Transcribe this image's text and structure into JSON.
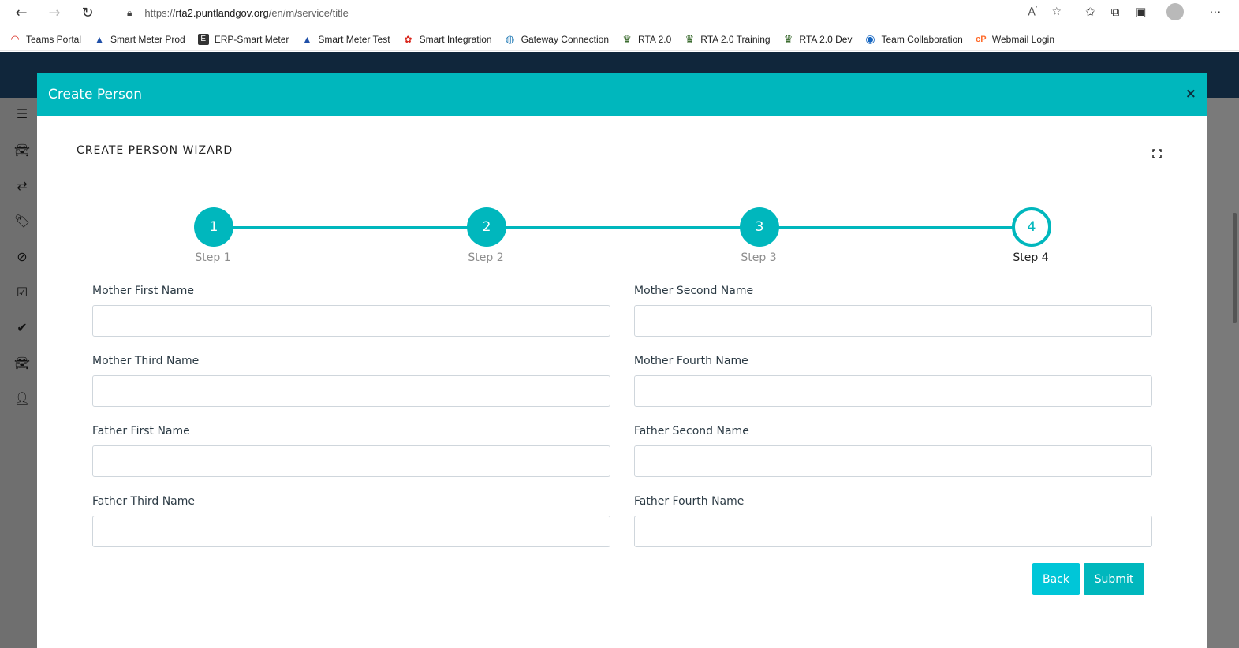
{
  "browser": {
    "url_prefix": "https://",
    "url_host": "rta2.puntlandgov.org",
    "url_path": "/en/m/service/title",
    "bookmarks": [
      {
        "label": "Teams Portal",
        "color": "#d9261c"
      },
      {
        "label": "Smart Meter Prod",
        "color": "#1f4fa8"
      },
      {
        "label": "ERP-Smart Meter",
        "color": "#333333"
      },
      {
        "label": "Smart Meter Test",
        "color": "#1f4fa8"
      },
      {
        "label": "Smart Integration",
        "color": "#d9261c"
      },
      {
        "label": "Gateway Connection",
        "color": "#2a7fb8"
      },
      {
        "label": "RTA 2.0",
        "color": "#3b6b2f"
      },
      {
        "label": "RTA 2.0 Training",
        "color": "#3b6b2f"
      },
      {
        "label": "RTA 2.0 Dev",
        "color": "#3b6b2f"
      },
      {
        "label": "Team Collaboration",
        "color": "#1565c0"
      },
      {
        "label": "Webmail Login",
        "color": "#ff6c2c"
      }
    ]
  },
  "modal": {
    "title": "Create Person",
    "wizard_title": "CREATE PERSON WIZARD",
    "steps": [
      {
        "number": "1",
        "label": "Step 1"
      },
      {
        "number": "2",
        "label": "Step 2"
      },
      {
        "number": "3",
        "label": "Step 3"
      },
      {
        "number": "4",
        "label": "Step 4"
      }
    ],
    "fields": {
      "mother_first": "Mother First Name",
      "mother_second": "Mother Second Name",
      "mother_third": "Mother Third Name",
      "mother_fourth": "Mother Fourth Name",
      "father_first": "Father First Name",
      "father_second": "Father Second Name",
      "father_third": "Father Third Name",
      "father_fourth": "Father Fourth Name"
    },
    "buttons": {
      "back": "Back",
      "submit": "Submit"
    }
  },
  "colors": {
    "accent": "#00b7bd",
    "back_button": "#00c6d8",
    "header_dark": "#10263b"
  }
}
